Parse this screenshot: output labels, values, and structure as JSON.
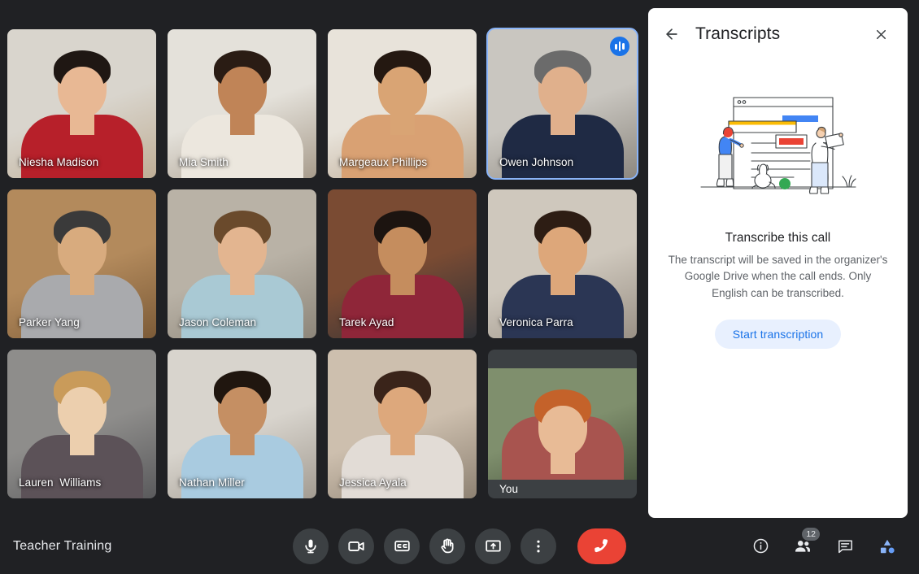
{
  "meeting": {
    "title": "Teacher Training"
  },
  "grid": {
    "participants": [
      {
        "name": "Niesha Madison",
        "speaking": false,
        "letterbox": false,
        "skin": "#e8b894",
        "hair": "#1f1713",
        "top": "#b7202a",
        "bg": "#d9d5cd",
        "bg2": "#bfae96"
      },
      {
        "name": "Mia Smith",
        "speaking": false,
        "letterbox": false,
        "skin": "#c08457",
        "hair": "#2a1c14",
        "top": "#ece7de",
        "bg": "#e4e1da",
        "bg2": "#a89c8c"
      },
      {
        "name": "Margeaux Phillips",
        "speaking": false,
        "letterbox": false,
        "skin": "#d9a474",
        "hair": "#241811",
        "top": "#d9a173",
        "bg": "#e8e3da",
        "bg2": "#b9a68f"
      },
      {
        "name": "Owen Johnson",
        "speaking": true,
        "letterbox": false,
        "skin": "#e0b08c",
        "hair": "#6b6b6b",
        "top": "#1f2a44",
        "bg": "#c9c6c0",
        "bg2": "#8d8880"
      },
      {
        "name": "Parker Yang",
        "speaking": false,
        "letterbox": false,
        "skin": "#d8ab7e",
        "hair": "#3a3a3a",
        "top": "#a9aaad",
        "bg": "#b38a5c",
        "bg2": "#7c5b38"
      },
      {
        "name": "Jason Coleman",
        "speaking": false,
        "letterbox": false,
        "skin": "#e3b590",
        "hair": "#6a4a2c",
        "top": "#a9c9d4",
        "bg": "#b9b2a6",
        "bg2": "#8d867a"
      },
      {
        "name": "Tarek Ayad",
        "speaking": false,
        "letterbox": false,
        "skin": "#c58d5e",
        "hair": "#1c1410",
        "top": "#8f2639",
        "bg": "#7a4b33",
        "bg2": "#2f3136"
      },
      {
        "name": "Veronica Parra",
        "speaking": false,
        "letterbox": false,
        "skin": "#dda77a",
        "hair": "#2d1d14",
        "top": "#2b3654",
        "bg": "#cfc8bd",
        "bg2": "#9a9186"
      },
      {
        "name": "Lauren  Williams",
        "speaking": false,
        "letterbox": false,
        "skin": "#eccfae",
        "hair": "#c99b5a",
        "top": "#5c5258",
        "bg": "#8e8d8b",
        "bg2": "#5a5a5c"
      },
      {
        "name": "Nathan Miller",
        "speaking": false,
        "letterbox": false,
        "skin": "#c58f63",
        "hair": "#20160f",
        "top": "#a9cbe0",
        "bg": "#d8d4cd",
        "bg2": "#a39c92"
      },
      {
        "name": "Jessica Ayala",
        "speaking": false,
        "letterbox": false,
        "skin": "#dda87c",
        "hair": "#3a241a",
        "top": "#e2dcd6",
        "bg": "#cdbfae",
        "bg2": "#8e8273"
      },
      {
        "name": "You",
        "speaking": false,
        "letterbox": true,
        "skin": "#e8bb96",
        "hair": "#c4622a",
        "top": "#a8544f",
        "bg": "#7f8f6d",
        "bg2": "#4d5a42"
      }
    ],
    "speaking_indicator_name": "active-speaker-audio-indicator"
  },
  "panel": {
    "title": "Transcripts",
    "back_label": "Back",
    "close_label": "Close",
    "transcribe_title": "Transcribe this call",
    "transcribe_description": "The transcript will be saved in the organizer's Google Drive when the call ends. Only English can be transcribed.",
    "start_button": "Start transcription",
    "illustration_name": "transcription-illustration"
  },
  "toolbar": {
    "controls": [
      {
        "name": "microphone-button",
        "icon": "microphone-icon",
        "label": "Turn off microphone"
      },
      {
        "name": "camera-button",
        "icon": "camera-icon",
        "label": "Turn off camera"
      },
      {
        "name": "captions-button",
        "icon": "closed-captions-icon",
        "label": "Turn on captions"
      },
      {
        "name": "raise-hand-button",
        "icon": "raise-hand-icon",
        "label": "Raise hand"
      },
      {
        "name": "present-button",
        "icon": "present-screen-icon",
        "label": "Present now"
      },
      {
        "name": "more-options-button",
        "icon": "more-vertical-icon",
        "label": "More options"
      },
      {
        "name": "end-call-button",
        "icon": "end-call-icon",
        "label": "Leave call"
      }
    ],
    "right_controls": [
      {
        "name": "meeting-details-button",
        "icon": "info-icon",
        "label": "Meeting details",
        "badge": ""
      },
      {
        "name": "people-button",
        "icon": "people-icon",
        "label": "Show everyone",
        "badge": "12"
      },
      {
        "name": "chat-button",
        "icon": "chat-icon",
        "label": "Chat with everyone",
        "badge": ""
      },
      {
        "name": "activities-button",
        "icon": "activities-icon",
        "label": "Activities",
        "badge": ""
      }
    ]
  },
  "colors": {
    "background": "#202124",
    "panel_background": "#ffffff",
    "accent_blue": "#1a73e8",
    "speaking_border": "#8ab4f8",
    "end_call_red": "#ea4335",
    "control_grey": "#3c4043",
    "badge_grey": "#5f6368"
  }
}
